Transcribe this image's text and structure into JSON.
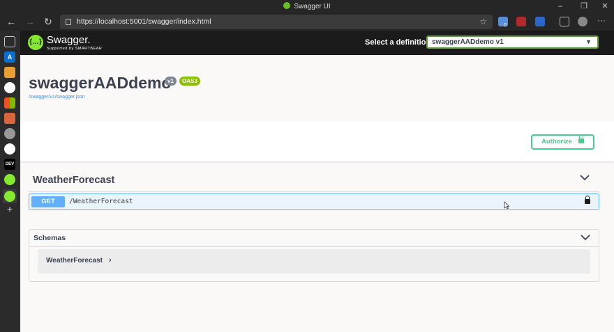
{
  "window": {
    "title": "Swagger UI",
    "controls": [
      "minimize",
      "restore",
      "close"
    ]
  },
  "browser": {
    "url": "https://localhost:5001/swagger/index.html",
    "nav": [
      "back-icon",
      "forward-icon",
      "refresh-icon"
    ],
    "extension_badge": "0",
    "menu": "···"
  },
  "sidebar_tabs": [
    "tab-icon",
    "azure-icon",
    "cloud-icon",
    "github-icon",
    "microsoft-icon",
    "pen-icon",
    "github-icon",
    "github-icon",
    "DEV",
    "swagger-icon",
    "swagger-icon",
    "+"
  ],
  "swagger": {
    "logo": {
      "name": "Swagger.",
      "sub": "Supported by SMARTBEAR"
    },
    "definition": {
      "label": "Select a definition",
      "selected": "swaggerAADdemo v1"
    },
    "api": {
      "title": "swaggerAADdemo",
      "version": "v1",
      "oas": "OAS3",
      "url": "/swagger/v1/swagger.json"
    },
    "authorize": "Authorize",
    "tag": {
      "name": "WeatherForecast"
    },
    "operation": {
      "method": "GET",
      "path": "/WeatherForecast"
    },
    "schemas": {
      "title": "Schemas",
      "items": [
        "WeatherForecast"
      ]
    }
  },
  "colors": {
    "accent": "#85ea2d",
    "get": "#61affe",
    "authorize": "#49cc90",
    "oas_badge": "#89bf04",
    "version_badge": "#7d8492"
  }
}
